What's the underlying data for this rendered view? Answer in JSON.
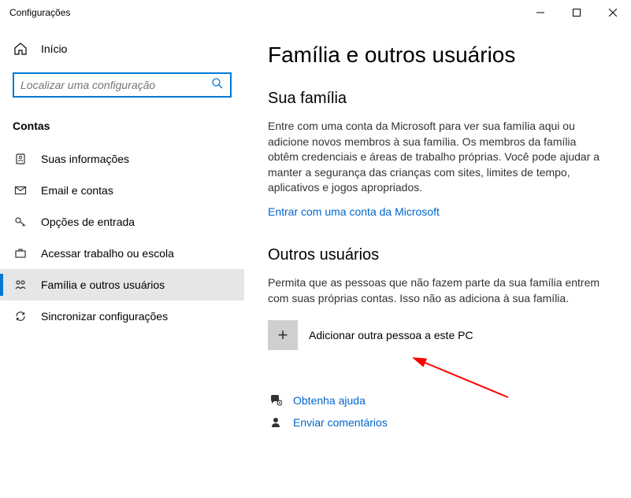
{
  "window": {
    "title": "Configurações"
  },
  "sidebar": {
    "home_label": "Início",
    "search_placeholder": "Localizar uma configuração",
    "section_label": "Contas",
    "items": [
      {
        "label": "Suas informações"
      },
      {
        "label": "Email e contas"
      },
      {
        "label": "Opções de entrada"
      },
      {
        "label": "Acessar trabalho ou escola"
      },
      {
        "label": "Família e outros usuários"
      },
      {
        "label": "Sincronizar configurações"
      }
    ]
  },
  "main": {
    "page_title": "Família e outros usuários",
    "family": {
      "title": "Sua família",
      "desc": "Entre com uma conta da Microsoft para ver sua família aqui ou adicione novos membros à sua família. Os membros da família obtêm credenciais e áreas de trabalho próprias. Você pode ajudar a manter a segurança das crianças com sites, limites de tempo, aplicativos e jogos apropriados.",
      "link": "Entrar com uma conta da Microsoft"
    },
    "other": {
      "title": "Outros usuários",
      "desc": "Permita que as pessoas que não fazem parte da sua família entrem com suas próprias contas. Isso não as adiciona à sua família.",
      "add_label": "Adicionar outra pessoa a este PC"
    },
    "footer": {
      "help": "Obtenha ajuda",
      "feedback": "Enviar comentários"
    }
  }
}
